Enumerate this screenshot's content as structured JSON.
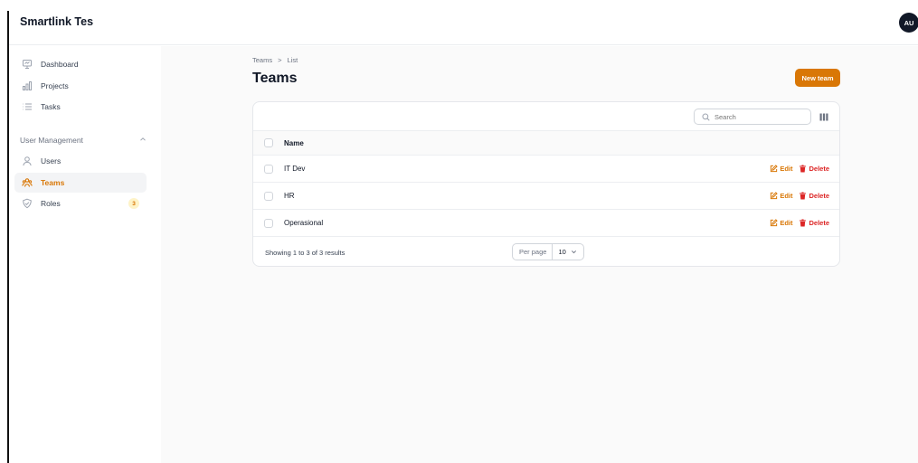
{
  "app": {
    "title": "Smartlink Tes",
    "avatar_initials": "AU"
  },
  "sidebar": {
    "items": [
      {
        "label": "Dashboard",
        "icon": "presentation-icon"
      },
      {
        "label": "Projects",
        "icon": "bar-chart-icon"
      },
      {
        "label": "Tasks",
        "icon": "list-icon"
      }
    ],
    "group": {
      "label": "User Management",
      "icon": "chevron-up-icon",
      "items": [
        {
          "label": "Users",
          "icon": "user-icon"
        },
        {
          "label": "Teams",
          "icon": "user-group-icon",
          "active": true
        },
        {
          "label": "Roles",
          "icon": "shield-check-icon",
          "badge": "3"
        }
      ]
    }
  },
  "breadcrumb": {
    "items": [
      "Teams",
      "List"
    ],
    "separator": ">"
  },
  "page": {
    "title": "Teams",
    "new_button_label": "New team"
  },
  "table": {
    "search_placeholder": "Search",
    "column_header": "Name",
    "rows": [
      {
        "name": "IT Dev"
      },
      {
        "name": "HR"
      },
      {
        "name": "Operasional"
      }
    ],
    "edit_label": "Edit",
    "delete_label": "Delete",
    "footer": {
      "showing_text": "Showing 1 to 3 of 3 results",
      "per_page_label": "Per page",
      "per_page_value": "10"
    }
  },
  "colors": {
    "accent": "#d97706",
    "danger": "#dc2626",
    "active_bg": "#f3f4f6"
  }
}
